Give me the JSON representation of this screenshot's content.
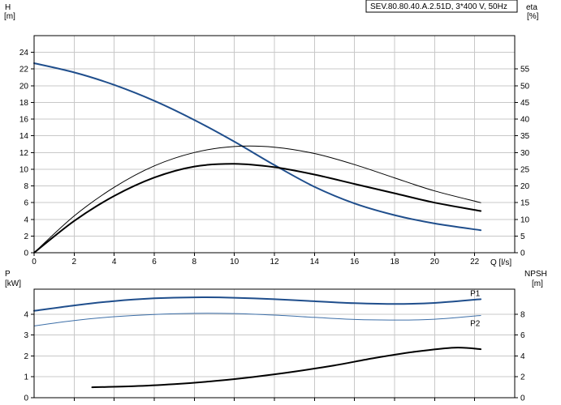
{
  "title_box": "SEV.80.80.40.A.2.51D, 3*400 V, 50Hz",
  "chart_data": [
    {
      "type": "line",
      "title": "SEV.80.80.40.A.2.51D, 3*400 V, 50Hz",
      "xlabel": "Q [l/s]",
      "ylabel_left": "H [m]",
      "ylabel_right": "eta [%]",
      "xlim": [
        0,
        24
      ],
      "ylim_left": [
        0,
        26
      ],
      "ylim_right": [
        0,
        65
      ],
      "x_ticks": [
        0,
        2,
        4,
        6,
        8,
        10,
        12,
        14,
        16,
        18,
        20,
        22
      ],
      "y_ticks_left": [
        0,
        2,
        4,
        6,
        8,
        10,
        12,
        14,
        16,
        18,
        20,
        22,
        24
      ],
      "y_ticks_right": [
        0,
        5,
        10,
        15,
        20,
        25,
        30,
        35,
        40,
        45,
        50,
        55
      ],
      "grid": true,
      "series": [
        {
          "axis": "left",
          "color": "#1f4e8c",
          "width": 2,
          "x": [
            0,
            2,
            4,
            6,
            8,
            10,
            12,
            14,
            16,
            18,
            20,
            22.3
          ],
          "y": [
            22.7,
            21.6,
            20.1,
            18.2,
            15.9,
            13.3,
            10.5,
            7.9,
            5.9,
            4.5,
            3.5,
            2.7
          ]
        },
        {
          "axis": "right",
          "color": "#000000",
          "width": 1,
          "x": [
            0,
            2,
            4,
            6,
            8,
            10,
            12,
            14,
            16,
            18,
            20,
            22.3
          ],
          "y": [
            0,
            11,
            19.6,
            26,
            30,
            31.8,
            31.6,
            29.7,
            26.4,
            22.4,
            18.5,
            15
          ]
        },
        {
          "axis": "right",
          "color": "#000000",
          "width": 2,
          "x": [
            0,
            2,
            4,
            6,
            8,
            10,
            12,
            14,
            16,
            18,
            20,
            22.3
          ],
          "y": [
            0,
            9.5,
            17,
            22.5,
            25.8,
            26.6,
            25.6,
            23.4,
            20.6,
            17.8,
            15,
            12.5
          ]
        }
      ]
    },
    {
      "type": "line",
      "xlabel": "",
      "ylabel_left": "P [kW]",
      "ylabel_right": "NPSH [m]",
      "xlim": [
        0,
        24
      ],
      "ylim_left": [
        0,
        5.2
      ],
      "ylim_right": [
        0,
        10.4
      ],
      "y_ticks_left": [
        0,
        1,
        2,
        3,
        4
      ],
      "y_ticks_right": [
        0,
        2,
        4,
        6,
        8
      ],
      "grid": true,
      "series": [
        {
          "name": "P1",
          "axis": "left",
          "color": "#1f4e8c",
          "width": 2,
          "x": [
            0,
            2,
            4,
            6,
            8,
            10,
            12,
            14,
            16,
            18,
            20,
            22.3
          ],
          "y": [
            4.16,
            4.42,
            4.63,
            4.76,
            4.81,
            4.79,
            4.72,
            4.62,
            4.53,
            4.49,
            4.54,
            4.72
          ]
        },
        {
          "name": "P2",
          "axis": "left",
          "color": "#3d6fa8",
          "width": 1,
          "x": [
            0,
            2,
            4,
            6,
            8,
            10,
            12,
            14,
            16,
            18,
            20,
            22.3
          ],
          "y": [
            3.44,
            3.7,
            3.88,
            3.99,
            4.04,
            4.03,
            3.96,
            3.85,
            3.75,
            3.72,
            3.76,
            3.94
          ]
        },
        {
          "axis": "right",
          "color": "#000000",
          "width": 2,
          "x": [
            2.9,
            5,
            7,
            9,
            11,
            13,
            15,
            17,
            19,
            21,
            22.3
          ],
          "y": [
            1.0,
            1.1,
            1.3,
            1.6,
            2.0,
            2.5,
            3.1,
            3.8,
            4.4,
            4.8,
            4.65
          ]
        }
      ]
    }
  ]
}
